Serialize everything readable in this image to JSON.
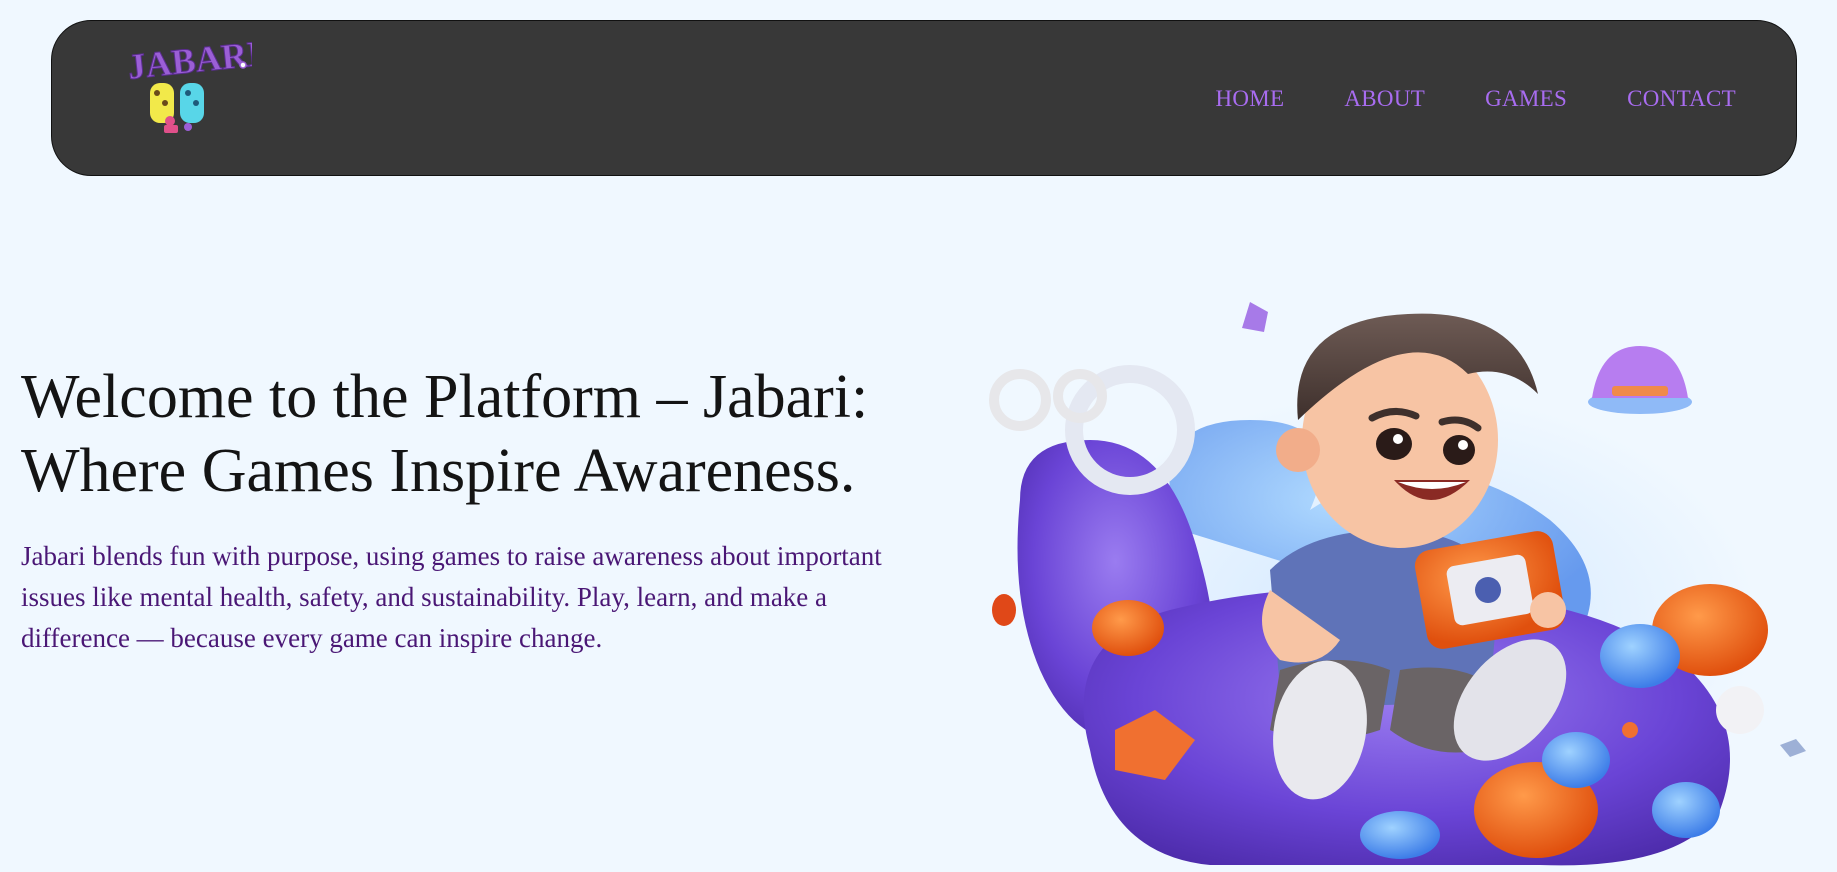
{
  "header": {
    "logo_text": "JABARI",
    "nav": [
      {
        "label": "HOME"
      },
      {
        "label": "ABOUT"
      },
      {
        "label": "GAMES"
      },
      {
        "label": "CONTACT"
      }
    ]
  },
  "hero": {
    "title_line1": "Welcome to the Platform – Jabari:",
    "title_line2": "Where Games Inspire Awareness.",
    "description": "Jabari blends fun with purpose, using games to raise awareness about important issues like mental health, safety, and sustainability. Play, learn, and make a difference — because every game can inspire change.",
    "illustration": "boy-playing-handheld-console-illustration"
  },
  "colors": {
    "background": "#f0f8ff",
    "navbar": "#383838",
    "nav_link": "#a86cf0",
    "title": "#141414",
    "description": "#4a1775",
    "accent_purple": "#7a4fe0",
    "accent_orange": "#f06a1e"
  }
}
